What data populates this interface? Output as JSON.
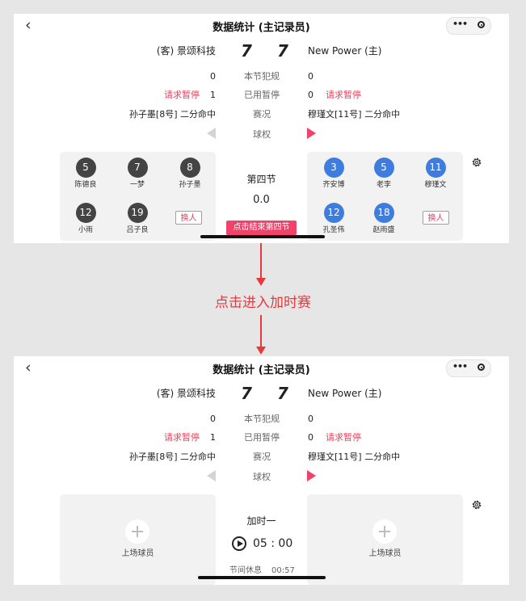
{
  "nav": {
    "title": "数据统计 (主记录员)",
    "back_icon": "‹",
    "more_icon": "•••"
  },
  "game": {
    "away_team": "(客) 景颂科技",
    "home_team": "New Power (主)",
    "away_score": "7",
    "home_score": "7",
    "rows": [
      {
        "left_value": "0",
        "label": "本节犯规",
        "right_value": "0",
        "right_extra": ""
      },
      {
        "left_value": "1",
        "left_extra": "请求暂停",
        "label": "已用暂停",
        "right_value": "0",
        "right_extra": "请求暂停"
      },
      {
        "left_value": "孙子墨[8号] 二分命中",
        "label": "赛况",
        "right_value": "穆瑾文[11号] 二分命中"
      }
    ],
    "possession_label": "球权"
  },
  "screen1": {
    "period": "第四节",
    "clock": "0.0",
    "end_button": "点击结束第四节",
    "away_players": [
      {
        "number": "5",
        "name": "陈德良"
      },
      {
        "number": "7",
        "name": "一梦"
      },
      {
        "number": "8",
        "name": "孙子墨"
      },
      {
        "number": "12",
        "name": "小雨"
      },
      {
        "number": "19",
        "name": "吕子良"
      }
    ],
    "home_players": [
      {
        "number": "3",
        "name": "齐安博"
      },
      {
        "number": "5",
        "name": "老李"
      },
      {
        "number": "11",
        "name": "穆瑾文"
      },
      {
        "number": "12",
        "name": "孔圣伟"
      },
      {
        "number": "18",
        "name": "赵雨盛"
      }
    ],
    "swap_label": "换人"
  },
  "annotation": "点击进入加时赛",
  "screen2": {
    "period": "加时一",
    "clock": "05 : 00",
    "break_label": "节间休息",
    "break_time": "00:57",
    "add_player_label": "上场球员"
  },
  "colors": {
    "accent": "#f0426a",
    "home_player": "#3e7de0",
    "away_player": "#444444",
    "annotation": "#e8383d"
  }
}
